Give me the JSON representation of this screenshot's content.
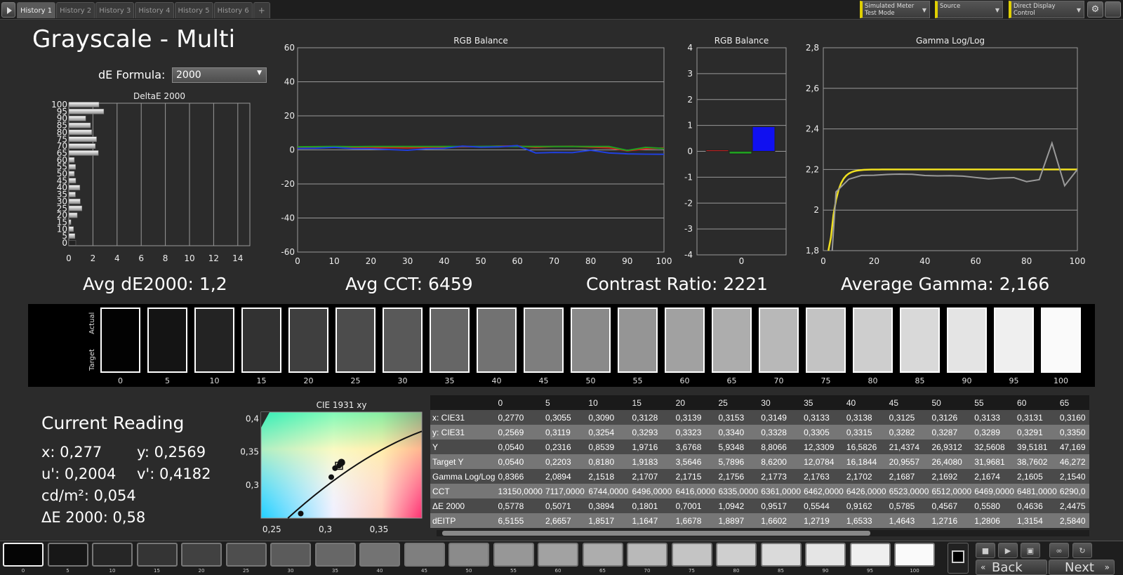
{
  "tabs": [
    "History 1",
    "History 2",
    "History 3",
    "History 4",
    "History 5",
    "History 6"
  ],
  "tab_add": "+",
  "top": {
    "meter_line1": "Simulated Meter",
    "meter_line2": "Test Mode",
    "source": "Source",
    "display": "Direct Display Control"
  },
  "page_title": "Grayscale - Multi",
  "de_formula": {
    "label": "dE Formula:",
    "value": "2000"
  },
  "stats": {
    "avg_de": "Avg dE2000: 1,2",
    "avg_cct": "Avg CCT: 6459",
    "contrast": "Contrast Ratio: 2221",
    "avg_gamma": "Average Gamma: 2,166"
  },
  "chart_data": [
    {
      "type": "bar",
      "orientation": "horizontal",
      "title": "DeltaE 2000",
      "categories": [
        0,
        5,
        10,
        15,
        20,
        25,
        30,
        35,
        40,
        45,
        50,
        55,
        60,
        65,
        70,
        75,
        80,
        85,
        90,
        95,
        100
      ],
      "values": [
        0.58,
        0.51,
        0.39,
        0.18,
        0.7,
        1.09,
        0.95,
        0.55,
        0.92,
        0.58,
        0.46,
        0.56,
        0.46,
        2.45,
        2.2,
        2.3,
        1.9,
        1.8,
        1.4,
        2.9,
        2.5
      ],
      "ytick_labels": [
        "0",
        "5",
        "10",
        "15",
        "20",
        "25",
        "30",
        "35",
        "40",
        "45",
        "50",
        "55",
        "60",
        "65",
        "70",
        "75",
        "80",
        "85",
        "90",
        "95",
        "100"
      ],
      "xticks": [
        0,
        2,
        4,
        6,
        8,
        10,
        12,
        14
      ],
      "xlim": [
        0,
        15
      ]
    },
    {
      "type": "line",
      "title": "RGB Balance",
      "x": [
        0,
        5,
        10,
        15,
        20,
        25,
        30,
        35,
        40,
        45,
        50,
        55,
        60,
        65,
        70,
        75,
        80,
        85,
        90,
        95,
        100
      ],
      "series": [
        {
          "color": "#d42020",
          "values": [
            1,
            1.2,
            1.5,
            1.3,
            1.2,
            1.4,
            1.2,
            1.5,
            1.6,
            1.8,
            1.9,
            2.2,
            2.3,
            1.5,
            2.0,
            2.1,
            1.6,
            1.2,
            -0.5,
            0.6,
            1.2
          ]
        },
        {
          "color": "#20a020",
          "values": [
            1.8,
            1.9,
            2.0,
            1.9,
            2.0,
            2.0,
            2.0,
            2.0,
            2.0,
            2.0,
            2.0,
            2.1,
            2.0,
            2.0,
            2.0,
            2.0,
            2.0,
            2.0,
            -0.3,
            1.5,
            0.8
          ]
        },
        {
          "color": "#2040e0",
          "values": [
            0.8,
            1.0,
            1.5,
            0.7,
            0.6,
            0.2,
            -0.2,
            0.6,
            0.9,
            2.2,
            1.6,
            1.8,
            2.5,
            -1.8,
            -1.5,
            -1.6,
            -0.2,
            -1.8,
            -2.3,
            -2.5,
            -2.6
          ]
        }
      ],
      "xticks": [
        0,
        10,
        20,
        30,
        40,
        50,
        60,
        70,
        80,
        90,
        100
      ],
      "yticks": [
        -60,
        -40,
        -20,
        0,
        20,
        40,
        60
      ],
      "ylim": [
        -60,
        60
      ]
    },
    {
      "type": "bar",
      "title": "RGB Balance",
      "categories": [
        "R",
        "G",
        "B"
      ],
      "values": [
        0.05,
        -0.1,
        0.95
      ],
      "colors": [
        "#d42020",
        "#20a020",
        "#1010f0"
      ],
      "xtick_label": "0",
      "yticks": [
        -4,
        -3,
        -2,
        -1,
        0,
        1,
        2,
        3,
        4
      ],
      "ylim": [
        -4,
        4
      ]
    },
    {
      "type": "line",
      "title": "Gamma Log/Log",
      "x": [
        0,
        5,
        10,
        15,
        20,
        25,
        30,
        35,
        40,
        45,
        50,
        55,
        60,
        65,
        70,
        75,
        80,
        85,
        90,
        95,
        100
      ],
      "series": [
        {
          "color": "#9a9a9a",
          "values": [
            0.8366,
            2.0894,
            2.1518,
            2.1707,
            2.1715,
            2.1756,
            2.1773,
            2.1763,
            2.1702,
            2.1687,
            2.1692,
            2.1674,
            2.1605,
            2.154,
            2.158,
            2.16,
            2.14,
            2.15,
            2.33,
            2.12,
            2.2
          ]
        },
        {
          "color": "#f0e020",
          "target_gamma": 2.2
        }
      ],
      "xticks": [
        0,
        20,
        40,
        60,
        80,
        100
      ],
      "yticks": [
        "1,8",
        "2",
        "2,2",
        "2,4",
        "2,6",
        "2,8"
      ],
      "ylim": [
        1.8,
        2.8
      ]
    },
    {
      "type": "scatter",
      "title": "CIE 1931 xy",
      "points": [
        [
          0.277,
          0.2569
        ],
        [
          0.3055,
          0.3119
        ],
        [
          0.309,
          0.3254
        ],
        [
          0.3128,
          0.3293
        ],
        [
          0.3139,
          0.3323
        ],
        [
          0.3153,
          0.334
        ]
      ],
      "target": [
        0.3127,
        0.329
      ],
      "xticks": [
        "0,25",
        "0,3",
        "0,35"
      ],
      "yticks": [
        "0,3",
        "0,35",
        "0,4"
      ],
      "xlim": [
        0.24,
        0.39
      ],
      "ylim": [
        0.25,
        0.41
      ]
    }
  ],
  "swatches": {
    "actual_label": "Actual",
    "target_label": "Target",
    "levels": [
      "0",
      "5",
      "10",
      "15",
      "20",
      "25",
      "30",
      "35",
      "40",
      "45",
      "50",
      "55",
      "60",
      "65",
      "70",
      "75",
      "80",
      "85",
      "90",
      "95",
      "100"
    ]
  },
  "current": {
    "title": "Current Reading",
    "x": "x: 0,277",
    "y": "y: 0,2569",
    "u": "u': 0,2004",
    "v": "v': 0,4182",
    "cd": "cd/m²: 0,054",
    "de": "ΔE 2000: 0,58"
  },
  "table": {
    "headers": [
      "",
      "0",
      "5",
      "10",
      "15",
      "20",
      "25",
      "30",
      "35",
      "40",
      "45",
      "50",
      "55",
      "60",
      "65"
    ],
    "rows": [
      [
        "x: CIE31",
        "0,2770",
        "0,3055",
        "0,3090",
        "0,3128",
        "0,3139",
        "0,3153",
        "0,3149",
        "0,3133",
        "0,3138",
        "0,3125",
        "0,3126",
        "0,3133",
        "0,3131",
        "0,3160"
      ],
      [
        "y: CIE31",
        "0,2569",
        "0,3119",
        "0,3254",
        "0,3293",
        "0,3323",
        "0,3340",
        "0,3328",
        "0,3305",
        "0,3315",
        "0,3282",
        "0,3287",
        "0,3289",
        "0,3291",
        "0,3350"
      ],
      [
        "Y",
        "0,0540",
        "0,2316",
        "0,8539",
        "1,9716",
        "3,6768",
        "5,9348",
        "8,8066",
        "12,3309",
        "16,5826",
        "21,4374",
        "26,9312",
        "32,5608",
        "39,5181",
        "47,169"
      ],
      [
        "Target Y",
        "0,0540",
        "0,2203",
        "0,8180",
        "1,9183",
        "3,5646",
        "5,7896",
        "8,6200",
        "12,0784",
        "16,1844",
        "20,9557",
        "26,4080",
        "31,9681",
        "38,7602",
        "46,272"
      ],
      [
        "Gamma Log/Log",
        "0,8366",
        "2,0894",
        "2,1518",
        "2,1707",
        "2,1715",
        "2,1756",
        "2,1773",
        "2,1763",
        "2,1702",
        "2,1687",
        "2,1692",
        "2,1674",
        "2,1605",
        "2,1540"
      ],
      [
        "CCT",
        "13150,0000",
        "7117,0000",
        "6744,0000",
        "6496,0000",
        "6416,0000",
        "6335,0000",
        "6361,0000",
        "6462,0000",
        "6426,0000",
        "6523,0000",
        "6512,0000",
        "6469,0000",
        "6481,0000",
        "6290,0"
      ],
      [
        "ΔE 2000",
        "0,5778",
        "0,5071",
        "0,3894",
        "0,1801",
        "0,7001",
        "1,0942",
        "0,9517",
        "0,5544",
        "0,9162",
        "0,5785",
        "0,4567",
        "0,5580",
        "0,4636",
        "2,4475"
      ],
      [
        "dEITP",
        "6,5155",
        "2,6657",
        "1,8517",
        "1,1647",
        "1,6678",
        "1,8897",
        "1,6602",
        "1,2719",
        "1,6533",
        "1,4643",
        "1,2716",
        "1,2806",
        "1,3154",
        "2,5840"
      ]
    ]
  },
  "bottom": {
    "levels": [
      "0",
      "5",
      "10",
      "15",
      "20",
      "25",
      "30",
      "35",
      "40",
      "45",
      "50",
      "55",
      "60",
      "65",
      "70",
      "75",
      "80",
      "85",
      "90",
      "95",
      "100"
    ],
    "back": "Back",
    "next": "Next"
  }
}
